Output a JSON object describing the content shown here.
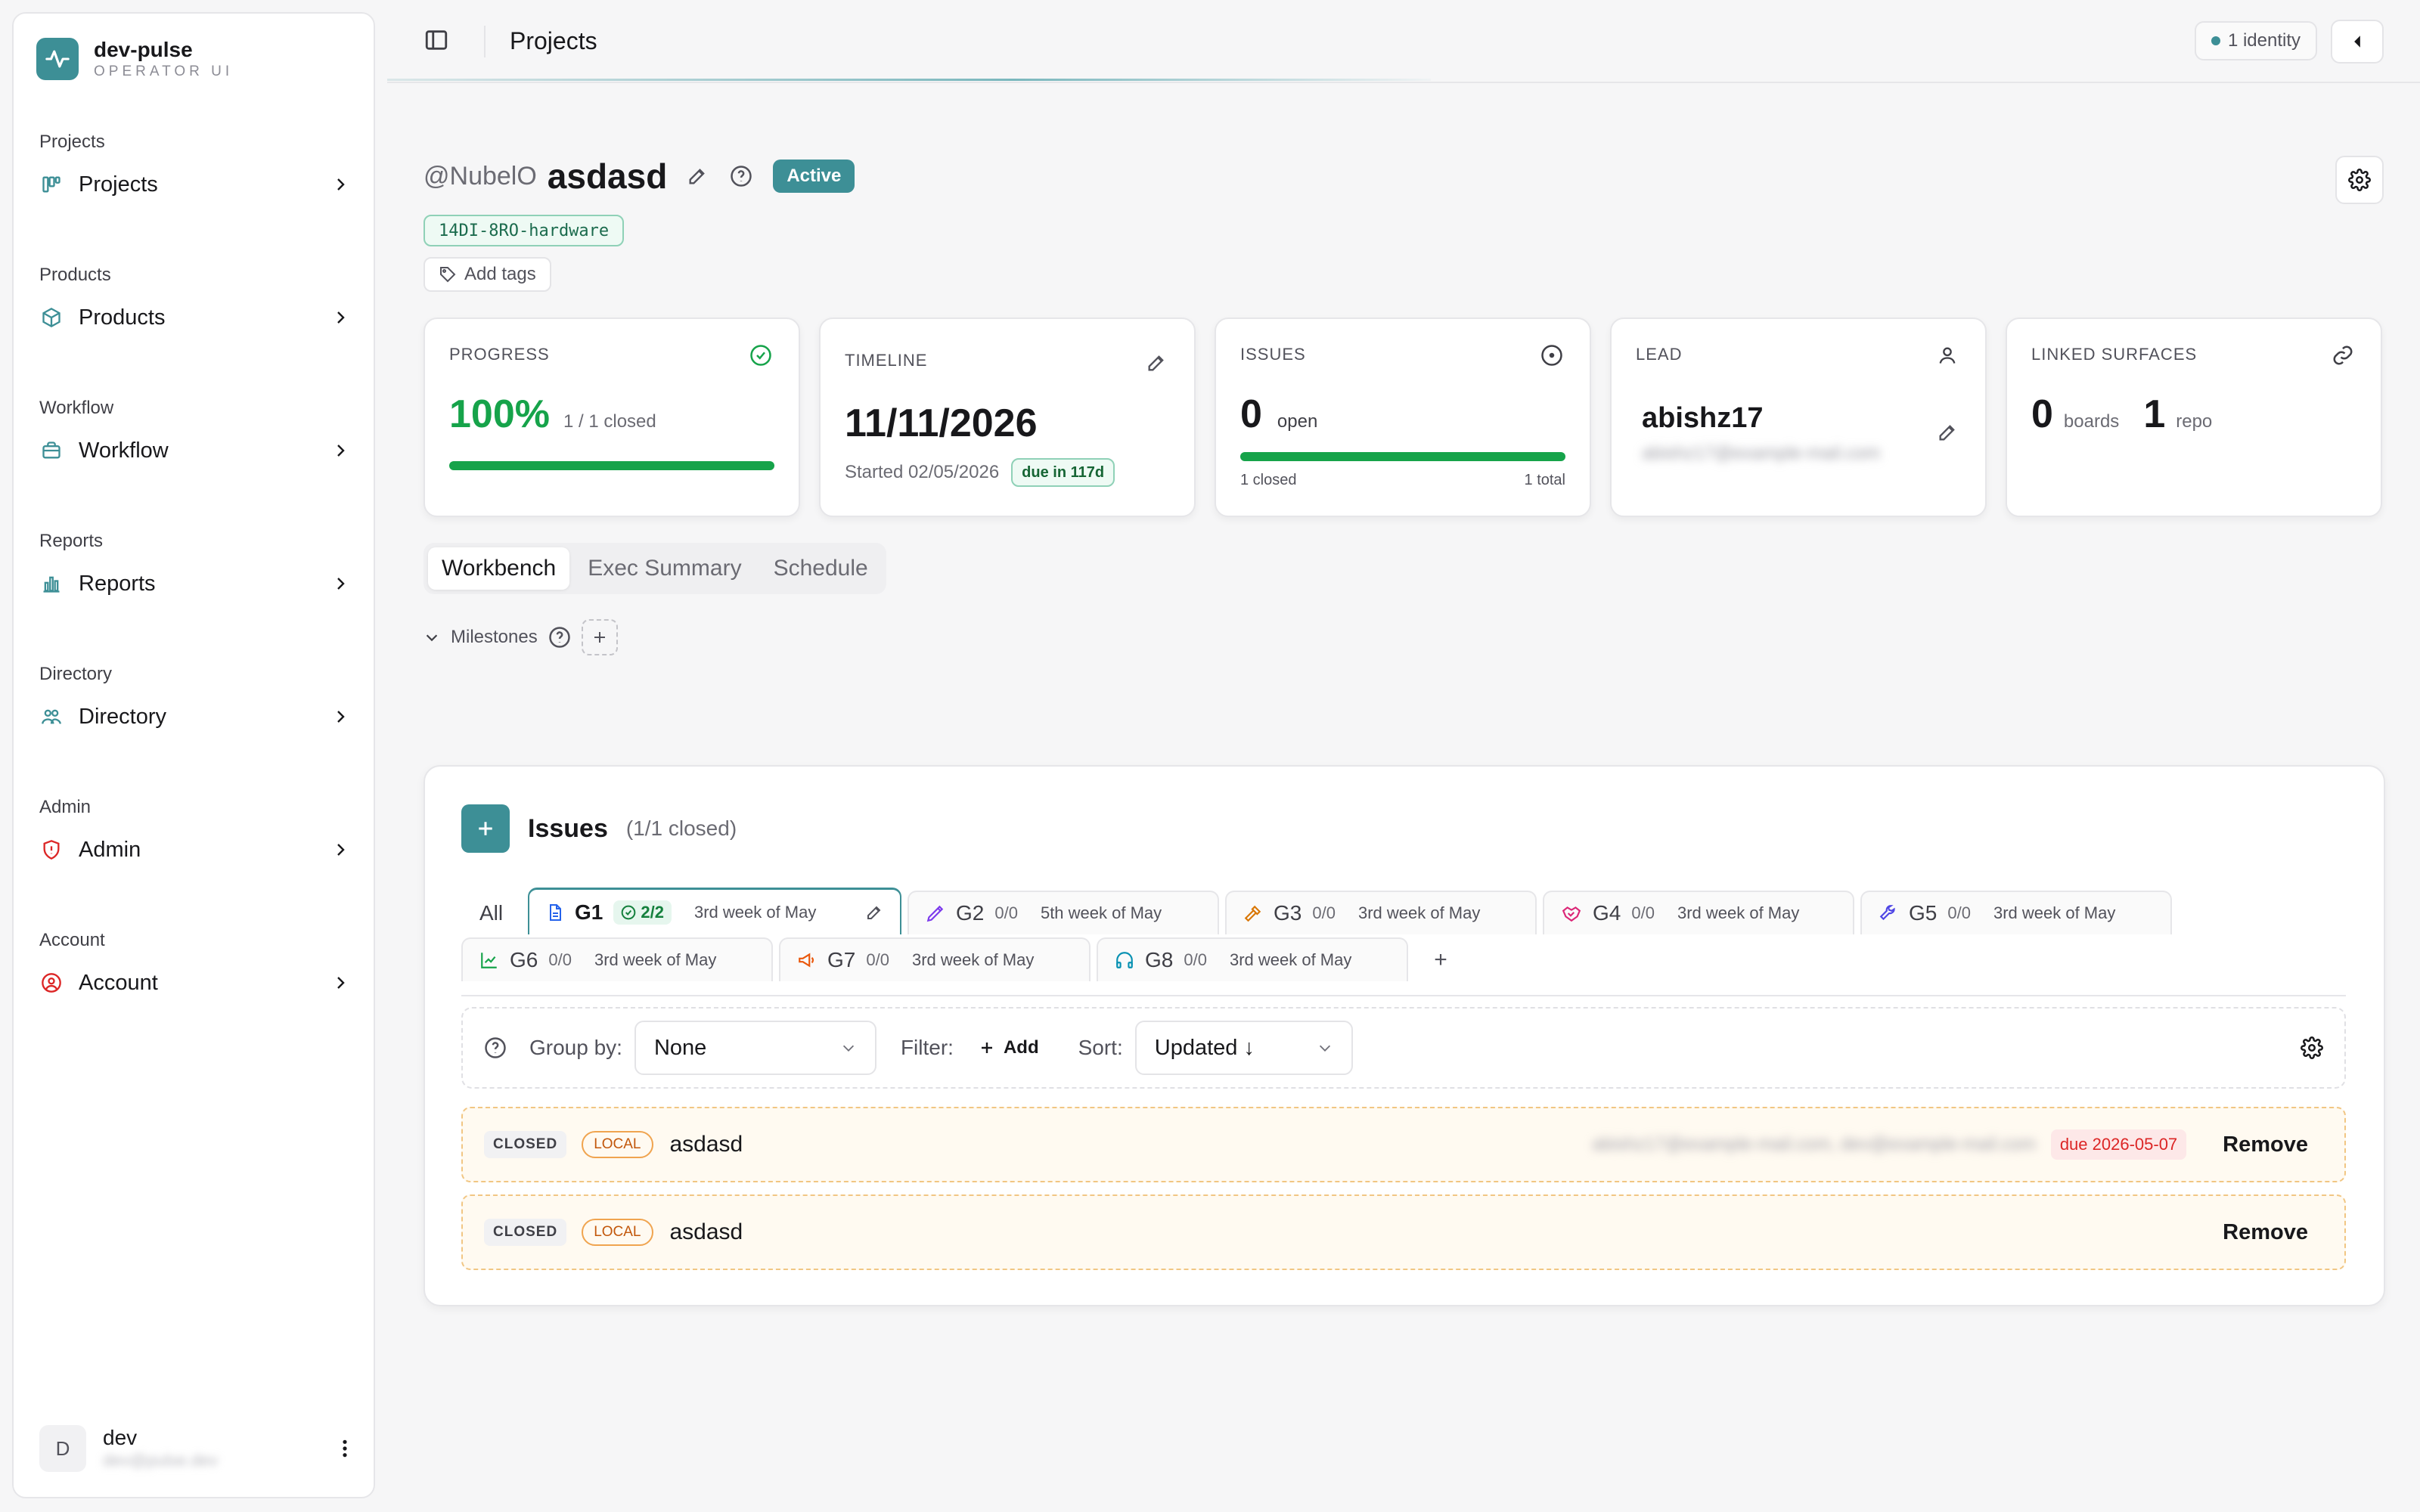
{
  "brand": {
    "name": "dev-pulse",
    "subtitle": "OPERATOR UI",
    "color": "#3d8f96"
  },
  "sidebar": {
    "groups": [
      {
        "label": "Projects",
        "item": "Projects",
        "icon": "kanban-icon"
      },
      {
        "label": "Products",
        "item": "Products",
        "icon": "box-icon"
      },
      {
        "label": "Workflow",
        "item": "Workflow",
        "icon": "briefcase-icon"
      },
      {
        "label": "Reports",
        "item": "Reports",
        "icon": "bar-chart-icon"
      },
      {
        "label": "Directory",
        "item": "Directory",
        "icon": "people-icon"
      },
      {
        "label": "Admin",
        "item": "Admin",
        "icon": "shield-icon"
      },
      {
        "label": "Account",
        "item": "Account",
        "icon": "user-circle-icon"
      }
    ],
    "user": {
      "initial": "D",
      "name": "dev",
      "email": "dev@pulse.dev"
    }
  },
  "topbar": {
    "title": "Projects",
    "identity": "1 identity"
  },
  "project": {
    "owner": "@NubelO",
    "name": "asdasd",
    "status": "Active",
    "code": "14DI-8RO-hardware",
    "add_tags": "Add tags"
  },
  "cards": {
    "progress": {
      "label": "PROGRESS",
      "value": "100%",
      "detail": "1 / 1 closed",
      "fraction": 1.0
    },
    "timeline": {
      "label": "TIMELINE",
      "date": "11/11/2026",
      "started": "Started 02/05/2026",
      "due": "due in 117d"
    },
    "issues": {
      "label": "ISSUES",
      "count": "0",
      "unit": "open",
      "closed": "1 closed",
      "total": "1 total",
      "fraction": 1.0
    },
    "lead": {
      "label": "LEAD",
      "name": "abishz17",
      "email": "abishz17@example-mail.com"
    },
    "linked": {
      "label": "LINKED SURFACES",
      "boards": "0",
      "boards_unit": "boards",
      "repos": "1",
      "repos_unit": "repo"
    }
  },
  "tabs": [
    "Workbench",
    "Exec Summary",
    "Schedule"
  ],
  "milestones": {
    "label": "Milestones"
  },
  "issues_panel": {
    "title": "Issues",
    "count": "(1/1 closed)",
    "all_label": "All",
    "groups": [
      {
        "name": "G1",
        "count": "2/2",
        "week": "3rd week of May",
        "icon": "document-icon",
        "color": "#2563eb"
      },
      {
        "name": "G2",
        "count": "0/0",
        "week": "5th week of May",
        "icon": "pen-icon",
        "color": "#7c3aed"
      },
      {
        "name": "G3",
        "count": "0/0",
        "week": "3rd week of May",
        "icon": "hammer-icon",
        "color": "#d97706"
      },
      {
        "name": "G4",
        "count": "0/0",
        "week": "3rd week of May",
        "icon": "handshake-icon",
        "color": "#db2777"
      },
      {
        "name": "G5",
        "count": "0/0",
        "week": "3rd week of May",
        "icon": "wrench-icon",
        "color": "#4f46e5"
      },
      {
        "name": "G6",
        "count": "0/0",
        "week": "3rd week of May",
        "icon": "chart-icon",
        "color": "#16a34a"
      },
      {
        "name": "G7",
        "count": "0/0",
        "week": "3rd week of May",
        "icon": "megaphone-icon",
        "color": "#ea580c"
      },
      {
        "name": "G8",
        "count": "0/0",
        "week": "3rd week of May",
        "icon": "headphones-icon",
        "color": "#0891b2"
      }
    ],
    "add_group": "+",
    "toolbar": {
      "group_by_label": "Group by:",
      "group_by_value": "None",
      "filter_label": "Filter:",
      "filter_add": "Add",
      "sort_label": "Sort:",
      "sort_value": "Updated ↓"
    },
    "rows": [
      {
        "state": "CLOSED",
        "source": "LOCAL",
        "title": "asdasd",
        "email": "abishz17@example-mail.com, dev@example-mail.com",
        "due": "due 2026-05-07",
        "action": "Remove"
      },
      {
        "state": "CLOSED",
        "source": "LOCAL",
        "title": "asdasd",
        "email": "",
        "due": "",
        "action": "Remove"
      }
    ]
  }
}
